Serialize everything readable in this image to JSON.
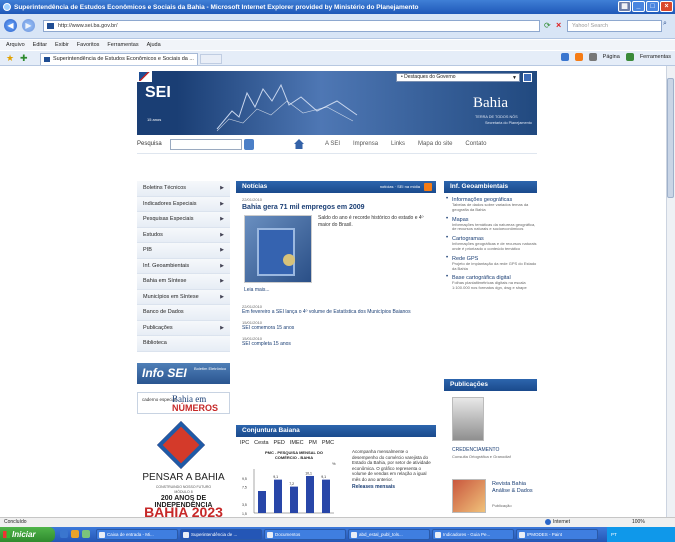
{
  "window": {
    "title": "Superintendência de Estudos Econômicos e Sociais da Bahia - Microsoft Internet Explorer provided by Ministério do Planejamento",
    "url": "http://www.sei.ba.gov.br/",
    "search_placeholder": "Yahoo! Search",
    "menu": [
      "Arquivo",
      "Editar",
      "Exibir",
      "Favoritos",
      "Ferramentas",
      "Ajuda"
    ],
    "tab_title": "Superintendência de Estudos Econômicos e Sociais da ...",
    "cmd_page": "Página",
    "cmd_tools": "Ferramentas"
  },
  "site": {
    "destaques": "• Destaques do Governo",
    "logo": "SEI",
    "logo_sub": "15 anos",
    "bahia": "Bahia",
    "bahia_sub": "TERRA DE TODOS NÓS",
    "bahia_sub2": "Secretaria do Planejamento",
    "pesquisa_label": "Pesquisa",
    "nav": [
      "A SEI",
      "Imprensa",
      "Links",
      "Mapa do site",
      "Contato"
    ]
  },
  "left_menu": [
    {
      "label": "Boletins Técnicos",
      "arrow": true
    },
    {
      "label": "Indicadores Especiais",
      "arrow": true
    },
    {
      "label": "Pesquisas Especiais",
      "arrow": true
    },
    {
      "label": "Estudos",
      "arrow": true
    },
    {
      "label": "PIB",
      "arrow": true
    },
    {
      "label": "Inf. Geoambientais",
      "arrow": true
    },
    {
      "label": "Bahia em Síntese",
      "arrow": true
    },
    {
      "label": "Municípios em Síntese",
      "arrow": true
    },
    {
      "label": "Banco de Dados",
      "arrow": false
    },
    {
      "label": "Publicações",
      "arrow": true
    },
    {
      "label": "Biblioteca",
      "arrow": false
    }
  ],
  "banners": {
    "infosei": "Info SEI",
    "infosei_small": "Boletim Eletrônico",
    "caderno": "caderno especial",
    "bahia_em": "Bahia em",
    "numeros": "NÚMEROS",
    "pensar": "PENSAR A BAHIA",
    "pensar_sub1": "CONSTRUINDO NOSSO FUTURO",
    "pensar_sub2": "MÓDULO 8",
    "pensar_sub3": "200 ANOS DE INDEPENDÊNCIA",
    "pensar_year": "BAHIA 2023"
  },
  "noticias": {
    "heading": "Notícias",
    "rss_label": "notícias · SEI na mídia",
    "date": "22/01/2010",
    "title": "Bahia gera 71 mil empregos em 2009",
    "text": "Saldo do ano é recorde histórico do estado e 4º maior do Brasil.",
    "leia": "Leia mais...",
    "items": [
      {
        "date": "22/01/2010",
        "text": "Em fevereiro a SEI lança o 4º volume de Estatística dos Municípios Baianos"
      },
      {
        "date": "15/01/2010",
        "text": "SEI comemora 15 anos"
      },
      {
        "date": "15/01/2010",
        "text": "SEI completa 15 anos"
      }
    ]
  },
  "conjuntura": {
    "heading": "Conjuntura Baiana",
    "tabs": [
      "IPC",
      "Cesta",
      "PED",
      "IMEC",
      "PM",
      "PMC"
    ],
    "chart_title": "PMC - PESQUISA MENSAL DO COMÉRCIO - BAHIA",
    "pct": "%",
    "text": "Acompanha mensalmente o desempenho do comércio varejista do Estado da Bahia, por setor de atividade econômica. O gráfico representa o volume de vendas em relação a igual mês do ano anterior.",
    "releases": "Releases mensais"
  },
  "chart_data": {
    "type": "bar",
    "title": "PMC - PESQUISA MENSAL DO COMÉRCIO - BAHIA",
    "categories": [
      "",
      "",
      "",
      "",
      ""
    ],
    "values": [
      6.0,
      9.1,
      7.2,
      10.1,
      9.1
    ],
    "ylim": [
      0,
      12
    ],
    "ytick_labels": [
      "",
      "9,5",
      "7,5",
      "",
      "3,5",
      "1,5"
    ],
    "data_labels": [
      "",
      "9,1",
      "7,2",
      "10,1",
      "9,1"
    ],
    "ylabel": "%",
    "xlabel": "",
    "grid": false
  },
  "geo": {
    "heading": "Inf. Geoambientais",
    "items": [
      {
        "title": "Informações geográficas",
        "desc": "Tabelas de dados sobre variados temas da geografia da Bahia"
      },
      {
        "title": "Mapas",
        "desc": "Informações temáticas da natureza geográfica, de recursos naturais e socioeconômicos"
      },
      {
        "title": "Cartogramas",
        "desc": "Informações geográficas e de recursos naturais onde é priorizado o conteúdo temático"
      },
      {
        "title": "Rede GPS",
        "desc": "Projeto de implantação da rede GPS do Estado da Bahia"
      },
      {
        "title": "Base cartográfica digital",
        "desc": "Folhas planialtimétricas digitais na escala 1:100.000 nos formatos dgn, dwg e shape"
      }
    ]
  },
  "pubs": {
    "heading": "Publicações",
    "p1_title": "CREDENCIAMENTO",
    "p1_desc": "Consulta Ortográfica e Granodiaf",
    "p2_title": "Revista Bahia Análise & Dados",
    "p2_desc": "Publicação"
  },
  "status": {
    "text": "Concluído",
    "zone": "Internet",
    "zoom": "100%"
  },
  "taskbar": {
    "start": "Iniciar",
    "tasks": [
      {
        "label": "Caixa de entrada - Mi..."
      },
      {
        "label": "Superintendência de ..."
      },
      {
        "label": "Documentos"
      },
      {
        "label": "abd_estal_publ_tols..."
      },
      {
        "label": "Indicadores - Guia Pe..."
      },
      {
        "label": "IPMODES - Paint"
      }
    ],
    "tray": "PT"
  },
  "colors": {
    "brand_blue": "#1a3e74",
    "header_blue": "#2d65ad",
    "accent_red": "#c62828"
  }
}
